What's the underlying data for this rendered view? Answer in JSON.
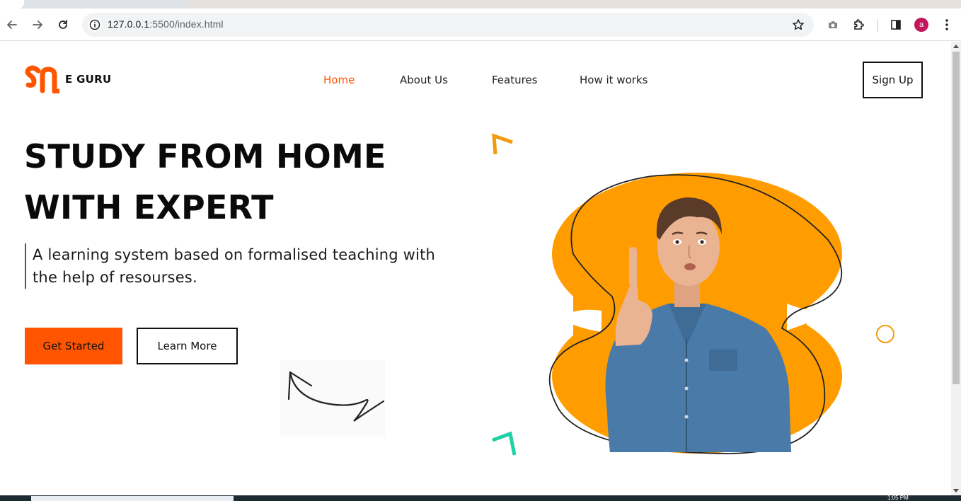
{
  "browser": {
    "url_host": "127.0.0.1",
    "url_path": ":5500/index.html",
    "profile_initial": "a",
    "icons": [
      "back-arrow-icon",
      "forward-arrow-icon",
      "reload-icon",
      "site-info-icon",
      "bookmark-star-icon",
      "camera-icon",
      "extensions-puzzle-icon",
      "side-panel-icon",
      "more-menu-icon"
    ]
  },
  "site": {
    "brand": "E GURU",
    "nav": [
      "Home",
      "About Us",
      "Features",
      "How it works"
    ],
    "active_nav": "Home",
    "signup_label": "Sign Up"
  },
  "hero": {
    "title_line1": "STUDY FROM HOME",
    "title_line2": "WITH EXPERT",
    "subtitle": "A learning system based on formalised teaching with the help of resourses.",
    "primary_button": "Get Started",
    "secondary_button": "Learn More"
  },
  "colors": {
    "accent": "#ff5500",
    "blob": "#ff9d00",
    "teal": "#1fd1a7",
    "profile": "#c2185b"
  },
  "taskbar": {
    "clock": "1:05 PM"
  }
}
